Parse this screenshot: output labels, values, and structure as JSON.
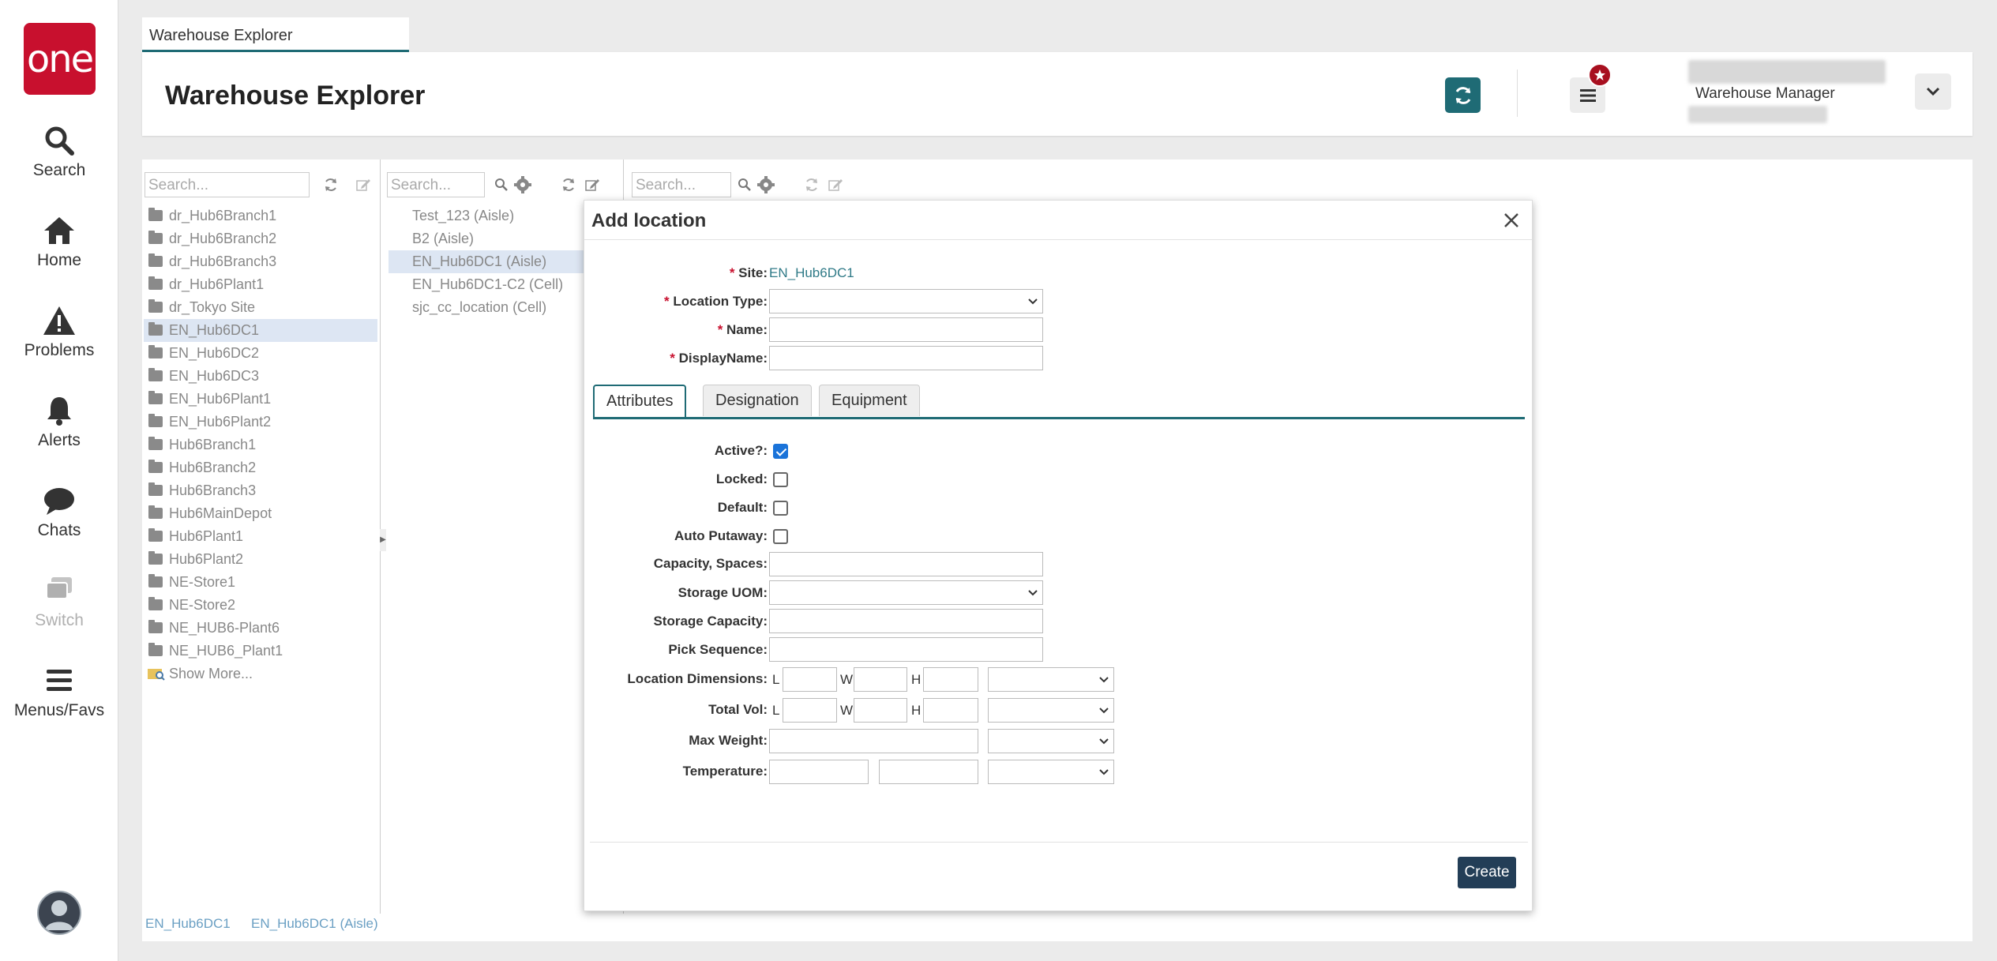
{
  "app": {
    "logo_text": "one",
    "tab_label": "Warehouse Explorer",
    "page_title": "Warehouse Explorer",
    "role": "Warehouse Manager",
    "accent": "#1f6b75",
    "brand": "#c8102e"
  },
  "nav": {
    "items": [
      {
        "label": "Search",
        "icon": "search-icon"
      },
      {
        "label": "Home",
        "icon": "home-icon"
      },
      {
        "label": "Problems",
        "icon": "warning-icon"
      },
      {
        "label": "Alerts",
        "icon": "bell-icon"
      },
      {
        "label": "Chats",
        "icon": "chat-icon"
      },
      {
        "label": "Switch",
        "icon": "switch-icon"
      },
      {
        "label": "Menus/Favs",
        "icon": "menu-icon"
      }
    ]
  },
  "panels": {
    "search_placeholder": "Search...",
    "sites": [
      "dr_Hub6Branch1",
      "dr_Hub6Branch2",
      "dr_Hub6Branch3",
      "dr_Hub6Plant1",
      "dr_Tokyo Site",
      "EN_Hub6DC1",
      "EN_Hub6DC2",
      "EN_Hub6DC3",
      "EN_Hub6Plant1",
      "EN_Hub6Plant2",
      "Hub6Branch1",
      "Hub6Branch2",
      "Hub6Branch3",
      "Hub6MainDepot",
      "Hub6Plant1",
      "Hub6Plant2",
      "NE-Store1",
      "NE-Store2",
      "NE_HUB6-Plant6",
      "NE_HUB6_Plant1"
    ],
    "show_more": "Show More...",
    "locations": [
      "Test_123 (Aisle)",
      "B2 (Aisle)",
      "EN_Hub6DC1 (Aisle)",
      "EN_Hub6DC1-C2 (Cell)",
      "sjc_cc_location (Cell)"
    ],
    "status_site": "EN_Hub6DC1",
    "status_location": "EN_Hub6DC1 (Aisle)"
  },
  "modal": {
    "title": "Add location",
    "site_label": "Site:",
    "site_value": "EN_Hub6DC1",
    "location_type_label": "Location Type:",
    "name_label": "Name:",
    "displayname_label": "DisplayName:",
    "tabs": [
      "Attributes",
      "Designation",
      "Equipment"
    ],
    "active_label": "Active?:",
    "locked_label": "Locked:",
    "default_label": "Default:",
    "auto_putaway_label": "Auto Putaway:",
    "capacity_label": "Capacity, Spaces:",
    "storage_uom_label": "Storage UOM:",
    "storage_capacity_label": "Storage Capacity:",
    "pick_sequence_label": "Pick Sequence:",
    "location_dimensions_label": "Location Dimensions:",
    "total_vol_label": "Total Vol:",
    "max_weight_label": "Max Weight:",
    "temperature_label": "Temperature:",
    "dim_l": "L",
    "dim_w": "W",
    "dim_h": "H",
    "create_label": "Create"
  }
}
